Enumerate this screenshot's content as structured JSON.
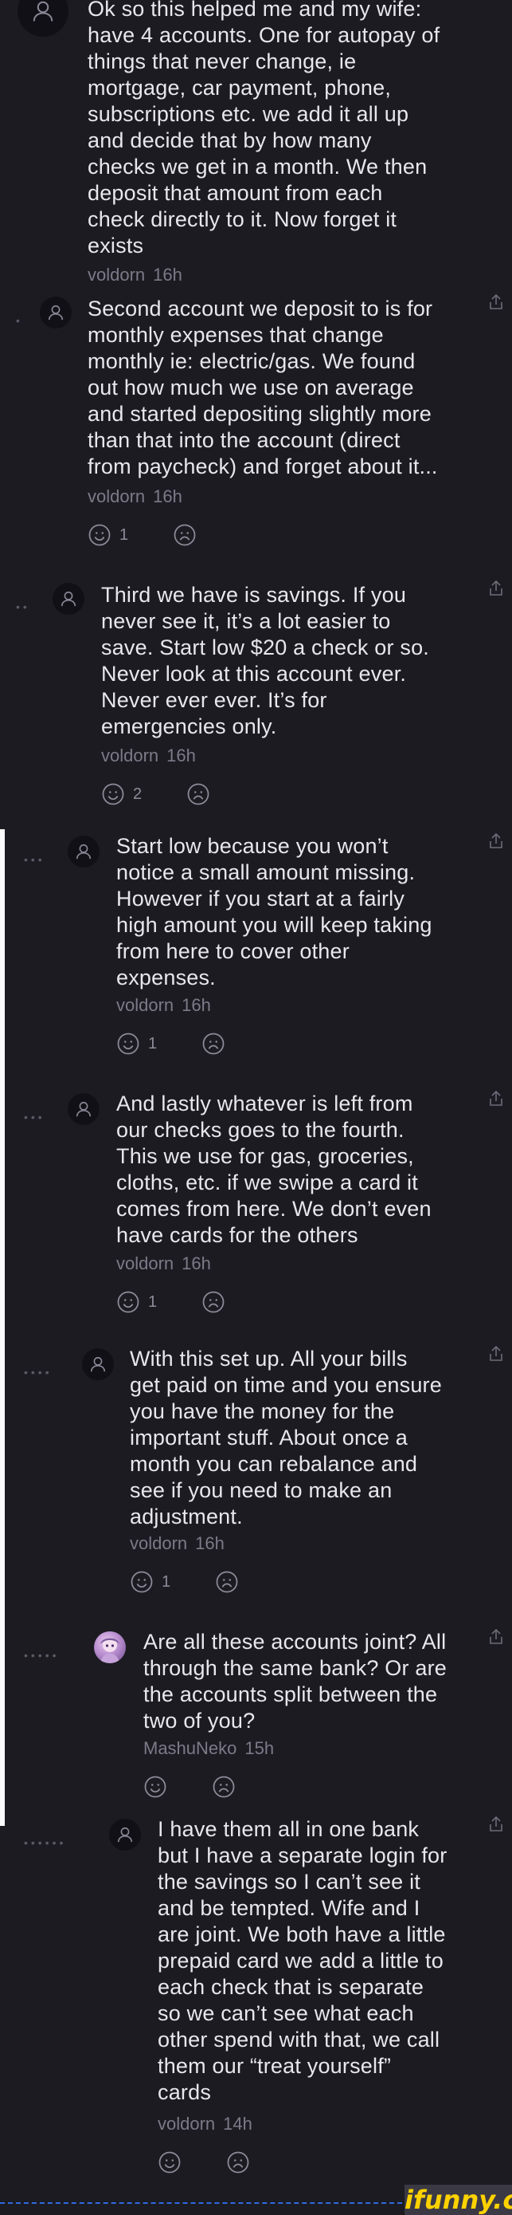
{
  "comments": [
    {
      "text": "Ok so this helped me and my wife:\nhave 4 accounts. One for autopay of\nthings that never change, ie\nmortgage, car payment, phone,\nsubscriptions etc. we add it all up\nand decide that by how many\nchecks we get in a month. We then\ndeposit that amount from each\ncheck directly to it. Now forget it\nexists",
      "author": "voldorn",
      "time": "16h"
    },
    {
      "text": "Second account we deposit to is for\nmonthly expenses that change\nmonthly ie: electric/gas. We found\nout how much we use on average\nand started depositing slightly more\nthan that into the account (direct\nfrom paycheck) and forget about it...",
      "author": "voldorn",
      "time": "16h",
      "likes": "1"
    },
    {
      "text": "Third we have is savings. If you\nnever see it, it’s a lot easier to\nsave. Start low $20 a check or so.\nNever look at this account ever.\nNever ever ever. It’s for\nemergencies only.",
      "author": "voldorn",
      "time": "16h",
      "likes": "2"
    },
    {
      "text": "Start low because you won’t\nnotice a small amount missing.\nHowever if you start at a fairly\nhigh amount you will keep taking\nfrom here to cover other\nexpenses.",
      "author": "voldorn",
      "time": "16h",
      "likes": "1"
    },
    {
      "text": "And lastly whatever is left from\nour checks goes to the fourth.\nThis we use for gas, groceries,\ncloths, etc. if we swipe a card it\ncomes from here. We don’t even\nhave cards for the others",
      "author": "voldorn",
      "time": "16h",
      "likes": "1"
    },
    {
      "text": "With this set up. All your bills\nget paid on time and you ensure\nyou have the money for the\nimportant stuff. About once a\nmonth you can rebalance and\nsee if you need to make an\nadjustment.",
      "author": "voldorn",
      "time": "16h",
      "likes": "1"
    },
    {
      "text": "Are all these accounts joint? All\nthrough the same bank? Or are\nthe accounts split between the\ntwo of you?",
      "author": "MashuNeko",
      "time": "15h"
    },
    {
      "text": "I have them all in one bank\nbut I have a separate login for\nthe savings so I can’t see it\nand be tempted. Wife and I\nare joint. We both have a little\nprepaid card we add a little to\neach check that is separate\nso we can’t see what each\nother spend with that, we call\nthem our “treat yourself”\ncards",
      "author": "voldorn",
      "time": "14h"
    }
  ],
  "watermark": "ifunny.co",
  "icons": {
    "avatar": "user-icon",
    "like": "smile-icon",
    "dislike": "frown-icon",
    "share": "share-icon"
  },
  "colors": {
    "background": "#1c1b22",
    "text": "#e8e7ec",
    "meta": "#7d7a88",
    "watermark": "#ffd200"
  }
}
